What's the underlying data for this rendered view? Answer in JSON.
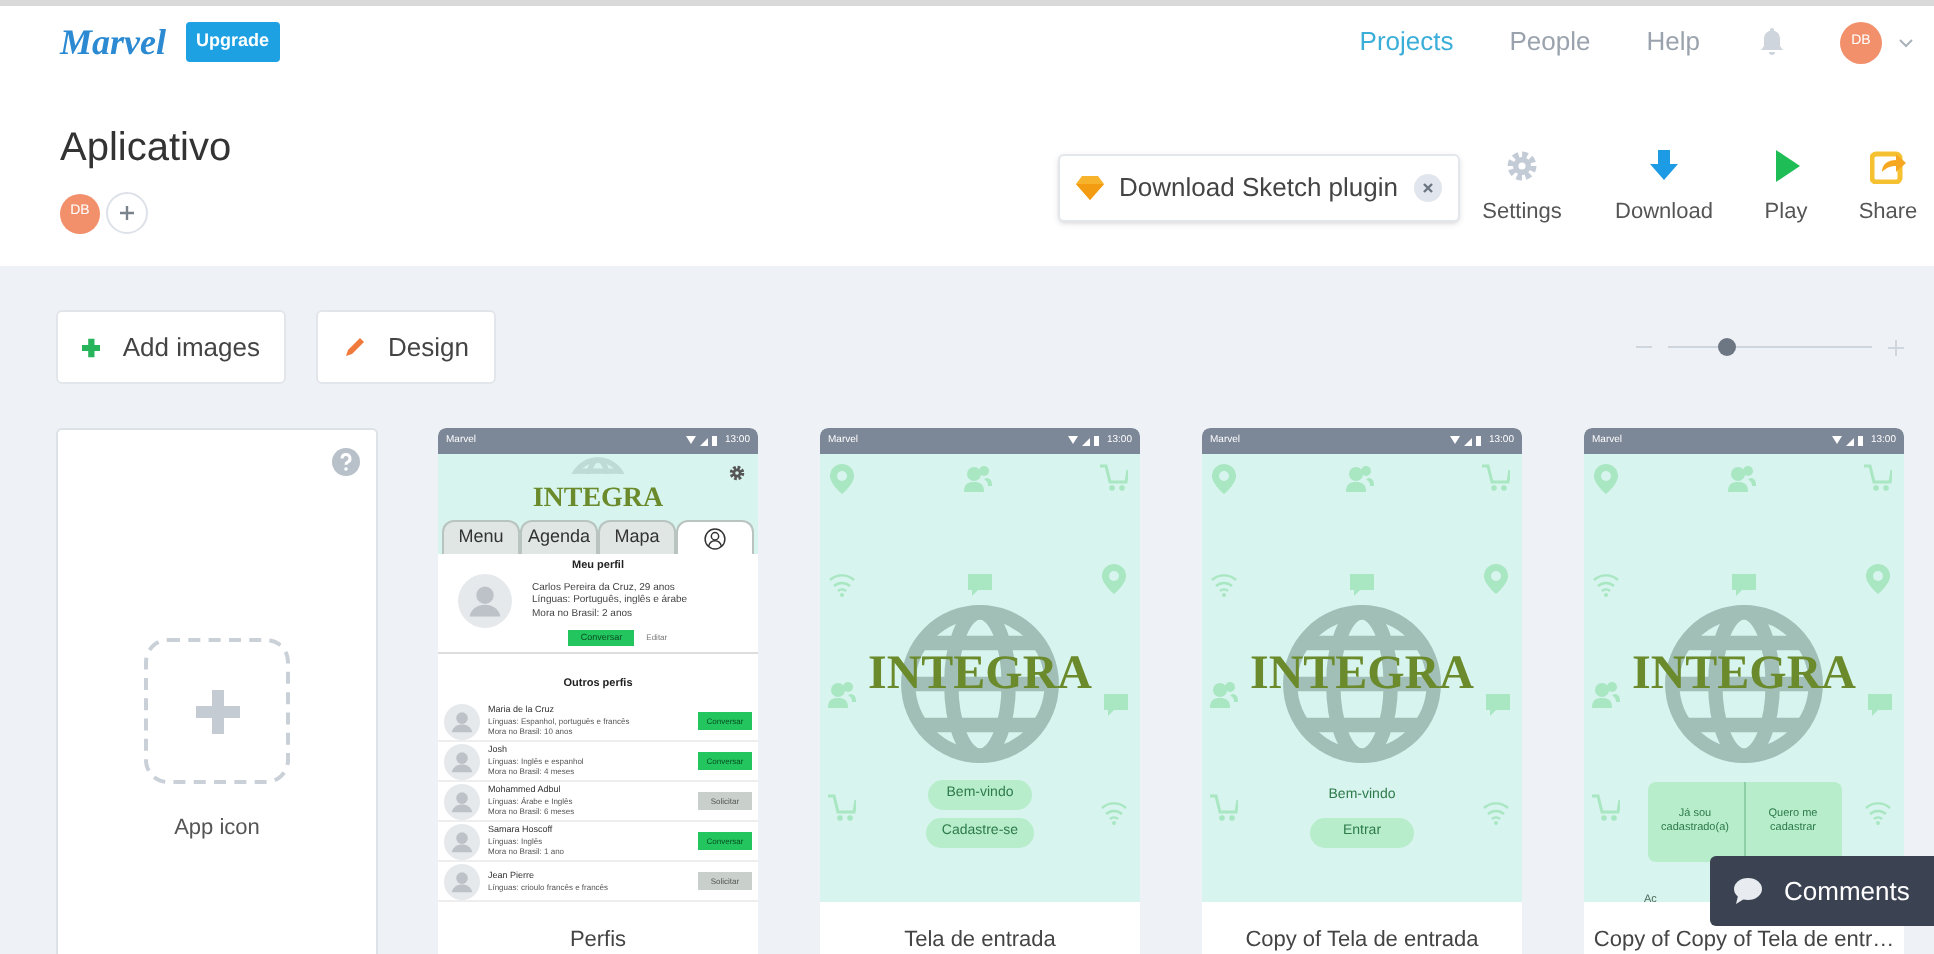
{
  "header": {
    "logo": "Marvel",
    "upgrade": "Upgrade",
    "nav": [
      {
        "label": "Projects",
        "selected": true
      },
      {
        "label": "People",
        "selected": false
      },
      {
        "label": "Help",
        "selected": false
      }
    ],
    "avatar": "DB"
  },
  "project": {
    "title": "Aplicativo",
    "members": [
      {
        "initials": "DB"
      }
    ]
  },
  "plugin_banner": {
    "text": "Download Sketch plugin"
  },
  "toolbar": [
    {
      "kind": "settings",
      "label": "Settings"
    },
    {
      "kind": "download",
      "label": "Download"
    },
    {
      "kind": "play",
      "label": "Play"
    },
    {
      "kind": "share",
      "label": "Share"
    }
  ],
  "actions": [
    {
      "kind": "add",
      "label": "Add images"
    },
    {
      "kind": "design",
      "label": "Design"
    }
  ],
  "zoom": {
    "level": 0.28
  },
  "app_icon": {
    "label": "App icon"
  },
  "screens": [
    {
      "label": "Perfis",
      "kind": "profiles",
      "status": {
        "carrier": "Marvel",
        "time": "13:00"
      },
      "logo": "INTEGRA",
      "tabs": [
        {
          "kind": "text",
          "label": "Menu",
          "selected": false
        },
        {
          "kind": "text",
          "label": "Agenda",
          "selected": false
        },
        {
          "kind": "text",
          "label": "Mapa",
          "selected": false
        },
        {
          "kind": "icon",
          "selected": true
        }
      ],
      "my_profile": {
        "heading": "Meu perfil",
        "lines": [
          "Carlos Pereira da Cruz, 29 anos",
          "Línguas: Português, inglês e árabe",
          "Mora no Brasil: 2 anos"
        ],
        "primary": "Conversar",
        "secondary": "Editar"
      },
      "others": {
        "heading": "Outros perfis",
        "rows": [
          {
            "name": "Maria de la Cruz",
            "lines": [
              "Línguas: Espanhol, português e francês",
              "Mora no Brasil: 10 anos"
            ],
            "button": {
              "kind": "primary",
              "label": "Conversar"
            }
          },
          {
            "name": "Josh",
            "lines": [
              "Línguas: Inglês e espanhol",
              "Mora no Brasil: 4 meses"
            ],
            "button": {
              "kind": "primary",
              "label": "Conversar"
            }
          },
          {
            "name": "Mohammed Adbul",
            "lines": [
              "Línguas: Árabe e Inglês",
              "Mora no Brasil: 6 meses"
            ],
            "button": {
              "kind": "secondary",
              "label": "Solicitar"
            }
          },
          {
            "name": "Samara Hoscoff",
            "lines": [
              "Línguas: Inglês",
              "Mora no Brasil: 1 ano"
            ],
            "button": {
              "kind": "primary",
              "label": "Conversar"
            }
          },
          {
            "name": "Jean Pierre",
            "lines": [
              "Línguas: crioulo francês e francês"
            ],
            "button": {
              "kind": "secondary",
              "label": "Solicitar"
            }
          }
        ]
      }
    },
    {
      "label": "Tela de entrada",
      "kind": "welcome",
      "status": {
        "carrier": "Marvel",
        "time": "13:00"
      },
      "logo": "INTEGRA",
      "elements": [
        {
          "kind": "pill",
          "text": "Bem-vindo"
        },
        {
          "kind": "pill",
          "text": "Cadastre-se"
        }
      ]
    },
    {
      "label": "Copy of Tela de entrada",
      "kind": "welcome",
      "status": {
        "carrier": "Marvel",
        "time": "13:00"
      },
      "logo": "INTEGRA",
      "elements": [
        {
          "kind": "plain",
          "text": "Bem-vindo"
        },
        {
          "kind": "pill",
          "text": "Entrar"
        }
      ]
    },
    {
      "label": "Copy of Copy of Tela de entr…",
      "kind": "welcome",
      "status": {
        "carrier": "Marvel",
        "time": "13:00"
      },
      "logo": "INTEGRA",
      "elements": [
        {
          "kind": "split",
          "parts": [
            "Já sou cadastrado(a)",
            "Quero me cadastrar"
          ]
        },
        {
          "kind": "caption",
          "text": "Ac"
        }
      ]
    }
  ],
  "comments": {
    "label": "Comments"
  }
}
